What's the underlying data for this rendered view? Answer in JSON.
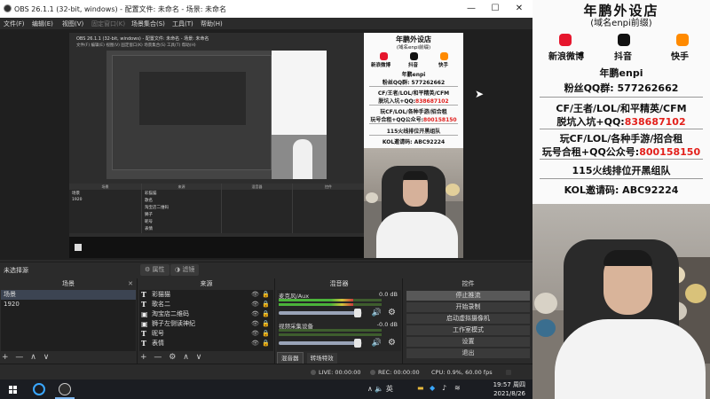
{
  "window": {
    "title": "OBS 26.1.1 (32-bit, windows) - 配置文件: 未命名 - 场景: 未命名",
    "controls": [
      "—",
      "☐",
      "✕"
    ]
  },
  "menu": [
    "文件(F)",
    "编辑(E)",
    "视图(V)",
    "固定窗口(K)",
    "场景集合(S)",
    "工具(T)",
    "帮助(H)"
  ],
  "inner_obs": {
    "title": "OBS 26.1.1 (32-bit, windows) - 配置文件: 未命名 - 场景: 未命名",
    "menu": "文件(F) 编辑(E) 视图(V) 固定窗口(K) 场景集合(S) 工具(T) 帮助(H)",
    "dock_titles": [
      "场景",
      "来源",
      "混音器",
      "转场特效",
      "控件"
    ],
    "scenes": [
      "场景",
      "1920"
    ],
    "sources": [
      "彩猫猫",
      "歌名",
      "淘宝店二维码",
      "狮子",
      "昵号",
      "表情"
    ]
  },
  "ad": {
    "title": "年鹏外设店",
    "subtitle": "(域名enpi前缀)",
    "socials": [
      {
        "label": "新浪微博",
        "icon": "weibo-icon",
        "color": "#e6162d"
      },
      {
        "label": "抖音",
        "icon": "douyin-icon",
        "color": "#111111"
      },
      {
        "label": "快手",
        "icon": "kuaishou-icon",
        "color": "#ff8a00"
      }
    ],
    "handle": "年鹏enpi",
    "qq_group": "粉丝QQ群: 577262662",
    "line1": "CF/王者/LOL/和平精英/CFM",
    "line2_prefix": "脱坑入坑+QQ:",
    "line2_value": "838687102",
    "line3": "玩CF/LOL/各种手游/招合租",
    "line4_prefix": "玩号合租+QQ公众号:",
    "line4_value": "800158150",
    "line5": "115火线排位开黑组队",
    "line6": "KOL邀请码: ABC92224",
    "accent": "#e3201b"
  },
  "docks": {
    "selector_label": "未选择源",
    "properties_button": "属性",
    "filters_button": "滤镜",
    "scenes": {
      "title": "场景",
      "items": [
        "场景",
        "1920"
      ],
      "footer": [
        "+",
        "—",
        "∧",
        "∨"
      ]
    },
    "sources": {
      "title": "来源",
      "items": [
        {
          "label": "彩猫猫",
          "icon": "text-source-icon"
        },
        {
          "label": "歌名二",
          "icon": "text-source-icon"
        },
        {
          "label": "淘宝店二维码",
          "icon": "image-source-icon"
        },
        {
          "label": "狮子左侧读神纪",
          "icon": "image-source-icon"
        },
        {
          "label": "昵号",
          "icon": "text-source-icon"
        },
        {
          "label": "表情",
          "icon": "text-source-icon"
        }
      ],
      "footer": [
        "+",
        "—",
        "⚙",
        "∧",
        "∨"
      ]
    },
    "mixer": {
      "title": "混音器",
      "channels": [
        {
          "name": "麦克风/Aux",
          "db": "0.0 dB",
          "level": 0.72,
          "volume": 0.95
        },
        {
          "name": "视频采集设备",
          "db": "-0.0 dB",
          "level": 0.0,
          "volume": 0.95
        }
      ],
      "tabs": [
        "混音器",
        "转场特效"
      ]
    },
    "controls": {
      "title": "控件",
      "buttons": [
        "停止推流",
        "开始录制",
        "启动虚拟摄像机",
        "工作室模式",
        "设置",
        "退出"
      ],
      "active_index": 0
    }
  },
  "status": {
    "live": "LIVE: 00:00:00",
    "rec": "REC: 00:00:00",
    "cpu": "CPU: 0.9%, 60.00 fps"
  },
  "taskbar": {
    "tray": "∧ 🔈 英",
    "time": "19:57 周四",
    "date": "2021/8/26"
  }
}
